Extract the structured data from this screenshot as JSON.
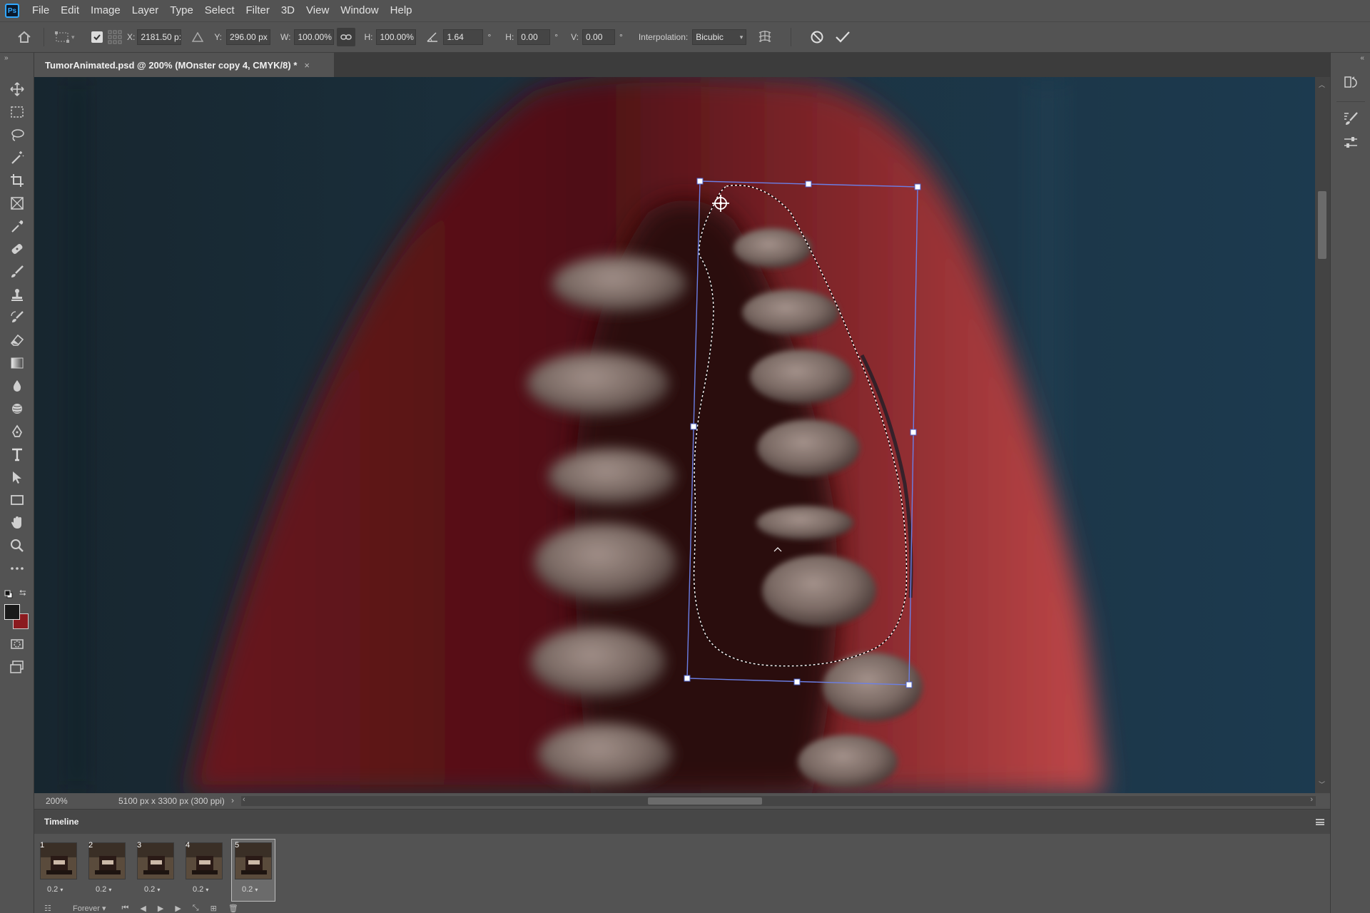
{
  "app": {
    "logo": "Ps"
  },
  "menu": [
    "File",
    "Edit",
    "Image",
    "Layer",
    "Type",
    "Select",
    "Filter",
    "3D",
    "View",
    "Window",
    "Help"
  ],
  "options": {
    "x_label": "X:",
    "x_value": "2181.50 p:",
    "y_label": "Y:",
    "y_value": "296.00 px",
    "w_label": "W:",
    "w_value": "100.00%",
    "h_label": "H:",
    "h_value": "100.00%",
    "angle_value": "1.64",
    "deg_symbol": "°",
    "hskew_label": "H:",
    "hskew_value": "0.00",
    "vskew_label": "V:",
    "vskew_value": "0.00",
    "interp_label": "Interpolation:",
    "interp_value": "Bicubic"
  },
  "document": {
    "tab_title": "TumorAnimated.psd @ 200% (MOnster copy 4, CMYK/8) *",
    "close_glyph": "×"
  },
  "status": {
    "zoom": "200%",
    "doc_info": "5100 px x 3300 px (300 ppi)"
  },
  "timeline": {
    "title": "Timeline",
    "frames": [
      {
        "num": "1",
        "delay": "0.2"
      },
      {
        "num": "2",
        "delay": "0.2"
      },
      {
        "num": "3",
        "delay": "0.2"
      },
      {
        "num": "4",
        "delay": "0.2"
      },
      {
        "num": "5",
        "delay": "0.2"
      }
    ],
    "selected_frame": 5,
    "loop": "Forever"
  },
  "colors": {
    "foreground": "#1a1a1a",
    "background": "#8b1a1f",
    "transform_box": "#6b7fe6"
  },
  "icons": {
    "toolbar": [
      "move-icon",
      "marquee-icon",
      "lasso-icon",
      "magic-wand-icon",
      "crop-icon",
      "frame-icon",
      "eyedropper-icon",
      "healing-icon",
      "brush-icon",
      "stamp-icon",
      "history-brush-icon",
      "eraser-icon",
      "gradient-icon",
      "blur-icon",
      "dodge-icon",
      "pen-icon",
      "type-icon",
      "path-select-icon",
      "rectangle-icon",
      "hand-icon",
      "zoom-icon",
      "more-icon"
    ]
  }
}
